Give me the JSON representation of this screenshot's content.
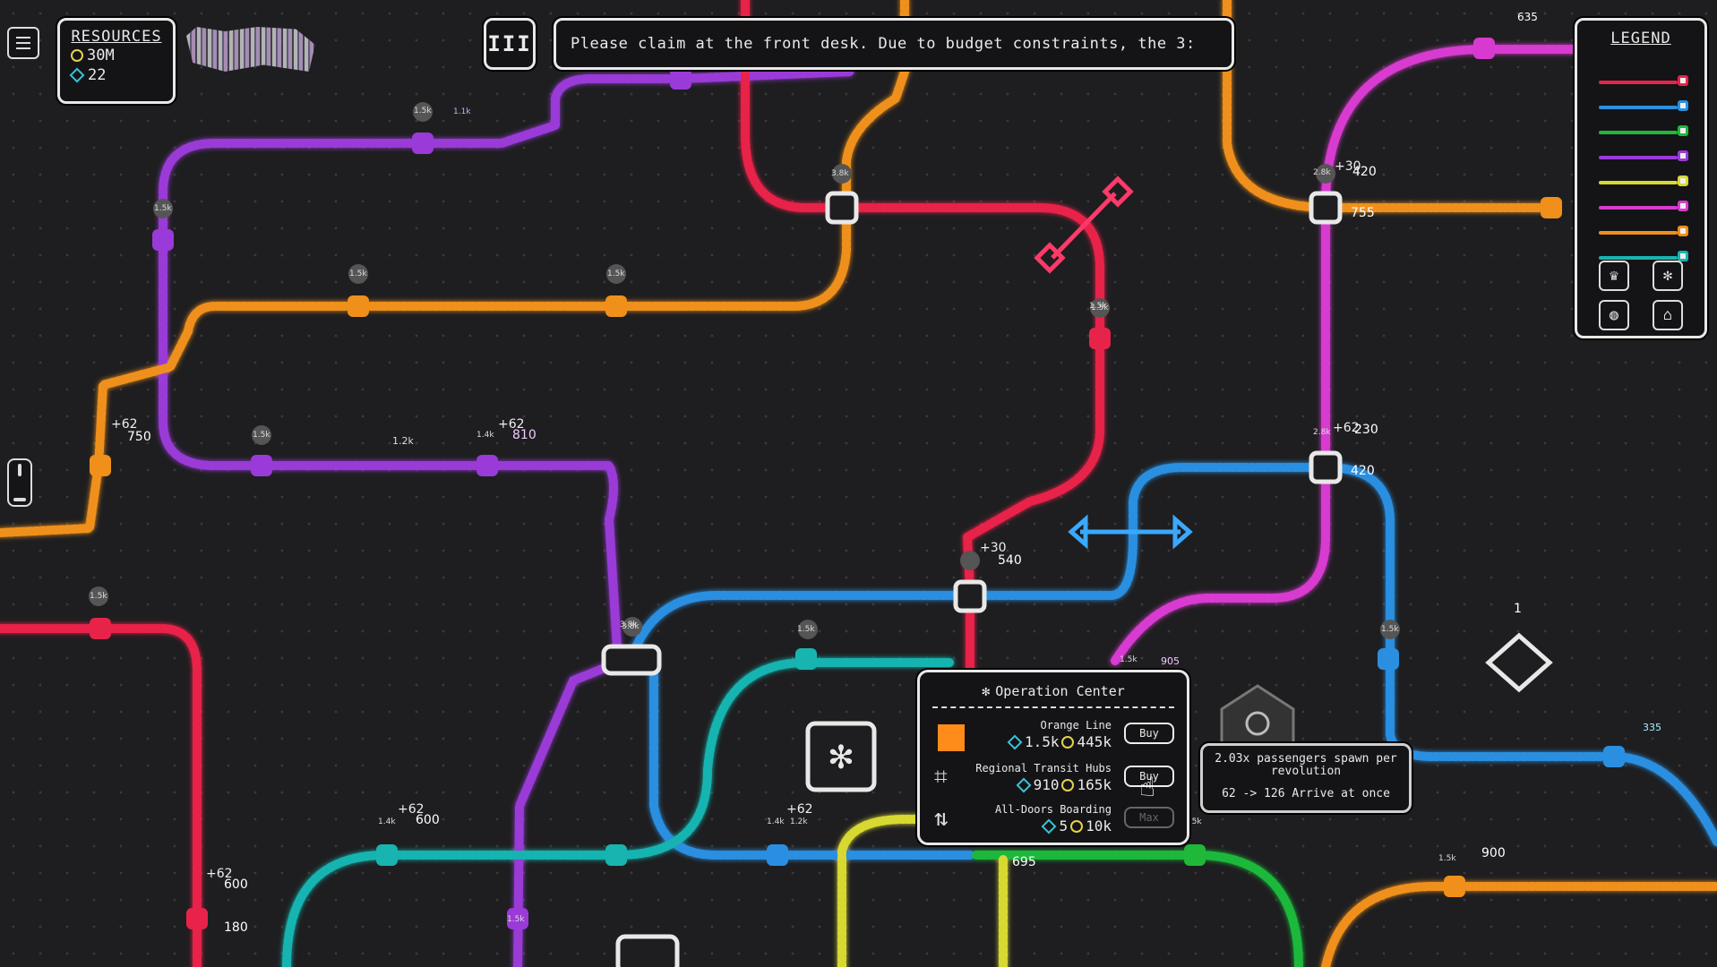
{
  "resources": {
    "title": "RESOURCES",
    "coins": "30M",
    "gems": "22"
  },
  "speed_button": {
    "label": "III"
  },
  "ticker": {
    "text": "Please claim at the front desk. Due to budget constraints, the 3:"
  },
  "legend": {
    "title": "LEGEND",
    "lines": [
      {
        "name": "red",
        "color": "#e8234a"
      },
      {
        "name": "blue",
        "color": "#2a8fe0"
      },
      {
        "name": "green",
        "color": "#1fb83a"
      },
      {
        "name": "purple",
        "color": "#9a3ad8"
      },
      {
        "name": "yellow",
        "color": "#d8d832"
      },
      {
        "name": "pink",
        "color": "#d83ad0"
      },
      {
        "name": "orange",
        "color": "#f0901a"
      },
      {
        "name": "teal",
        "color": "#18b4b0"
      }
    ],
    "buttons": [
      "crown-icon",
      "gear-icon",
      "globe-icon",
      "profile-icon"
    ]
  },
  "operation_center": {
    "title": "Operation Center",
    "items": [
      {
        "name": "Orange Line",
        "gems": "1.5k",
        "coins": "445k",
        "button": "Buy"
      },
      {
        "name": "Regional Transit Hubs",
        "gems": "910",
        "coins": "165k",
        "button": "Buy"
      },
      {
        "name": "All-Doors Boarding",
        "gems": "5",
        "coins": "10k",
        "button": "Max"
      }
    ]
  },
  "tooltip": {
    "line1": "2.03x passengers spawn per revolution",
    "line2": "62 -> 126 Arrive at once"
  },
  "station_labels": [
    {
      "text": "1.5k"
    },
    {
      "text": "1.1k"
    },
    {
      "text": "1.5k"
    },
    {
      "text": "1.5k"
    },
    {
      "text": "1.5k"
    },
    {
      "text": "3.8k"
    },
    {
      "text": "1.5k"
    },
    {
      "text": "1.5k"
    },
    {
      "text": "1.2k"
    },
    {
      "text": "1.4k"
    },
    {
      "text": "810"
    },
    {
      "text": "+62"
    },
    {
      "text": "750"
    },
    {
      "text": "+62"
    },
    {
      "text": "1.5k"
    },
    {
      "text": "3.8k"
    },
    {
      "text": "540"
    },
    {
      "text": "+30"
    },
    {
      "text": "1.5k"
    },
    {
      "text": "905"
    },
    {
      "text": "420"
    },
    {
      "text": "+62"
    },
    {
      "text": "230"
    },
    {
      "text": "2.8k"
    },
    {
      "text": "755"
    },
    {
      "text": "+30"
    },
    {
      "text": "420"
    },
    {
      "text": "635"
    },
    {
      "text": "1.5k"
    },
    {
      "text": "1.5k"
    },
    {
      "text": "600"
    },
    {
      "text": "+62"
    },
    {
      "text": "1.4k"
    },
    {
      "text": "1.2k"
    },
    {
      "text": "+62"
    },
    {
      "text": "1.4k"
    },
    {
      "text": "600"
    },
    {
      "text": "+62"
    },
    {
      "text": "180"
    },
    {
      "text": "695"
    },
    {
      "text": "1.5k"
    },
    {
      "text": "335"
    },
    {
      "text": "900"
    },
    {
      "text": "1"
    },
    {
      "text": "3.8k"
    },
    {
      "text": "1.5k"
    },
    {
      "text": "1.5k"
    },
    {
      "text": "1.5k"
    },
    {
      "text": "2.8k"
    }
  ]
}
